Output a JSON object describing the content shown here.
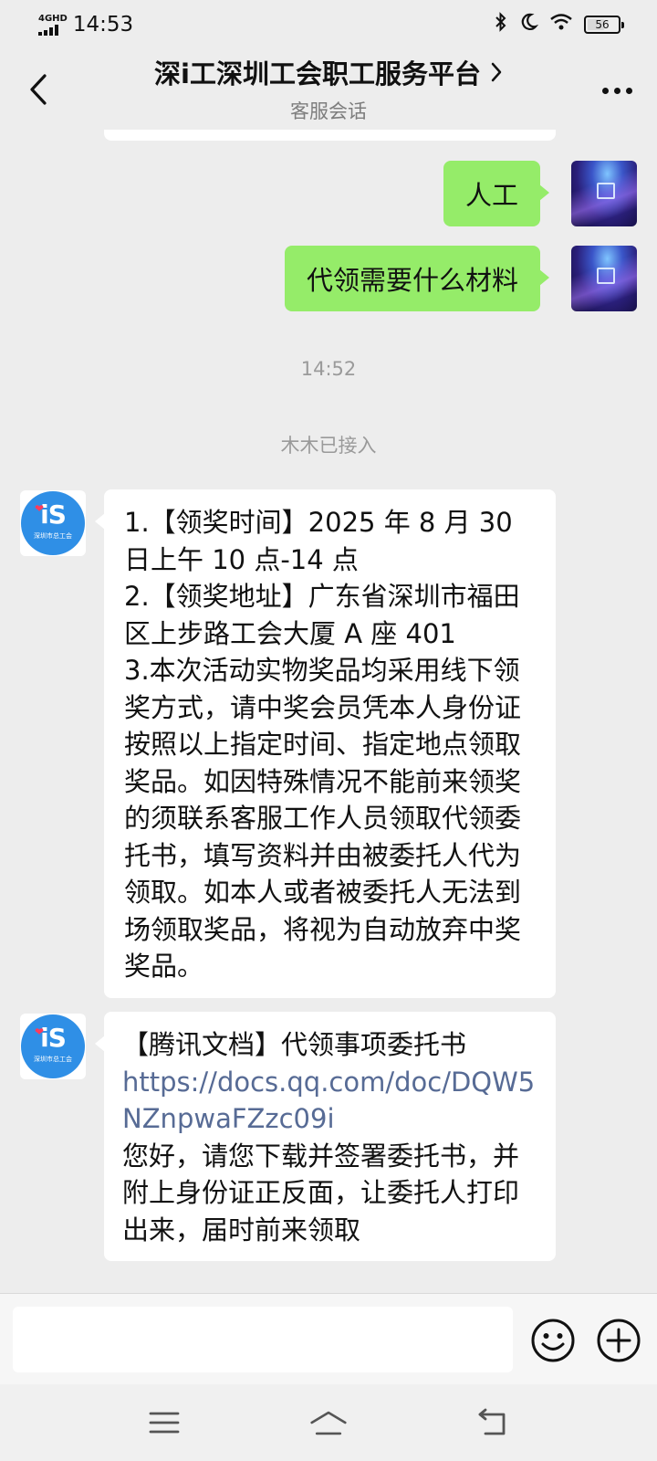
{
  "status_bar": {
    "network": "4GHD",
    "time": "14:53",
    "battery": "56",
    "battery_level": 0.56
  },
  "header": {
    "title": "深i工深圳工会职工服务平台",
    "subtitle": "客服会话"
  },
  "messages": {
    "me_1": "人工",
    "me_2": "代领需要什么材料",
    "time": "14:52",
    "system": "木木已接入",
    "them_1": {
      "l1": "1.【领奖时间】2025 年 8 月 30 日上午 10 点-14 点",
      "l2": "2.【领奖地址】广东省深圳市福田区上步路工会大厦 A 座 401",
      "l3": "3.本次活动实物奖品均采用线下领奖方式，请中奖会员凭本人身份证按照以上指定时间、指定地点领取奖品。如因特殊情况不能前来领奖的须联系客服工作人员领取代领委托书，填写资料并由被委托人代为领取。如本人或者被委托人无法到场领取奖品，将视为自动放弃中奖奖品。"
    },
    "them_2": {
      "title": "【腾讯文档】代领事项委托书",
      "link": "https://docs.qq.com/doc/DQW5NZnpwaFZzc09i",
      "body": "您好，请您下载并签署委托书，并附上身份证正反面，让委托人打印出来，届时前来领取"
    }
  },
  "avatar_them": {
    "mark": "iS",
    "caption": "深圳市总工会"
  },
  "icons": {
    "back": "chevron-left-icon",
    "title_arrow": "chevron-right-icon",
    "more": "more-dots-icon",
    "emoji": "emoji-icon",
    "plus": "plus-circle-icon",
    "nav_menu": "menu-icon",
    "nav_home": "home-icon",
    "nav_back": "return-icon"
  },
  "colors": {
    "my_bubble": "#95ec69",
    "their_bubble": "#ffffff",
    "background": "#ededed",
    "link": "#576b95",
    "avatar_blue": "#2f8fe6"
  }
}
